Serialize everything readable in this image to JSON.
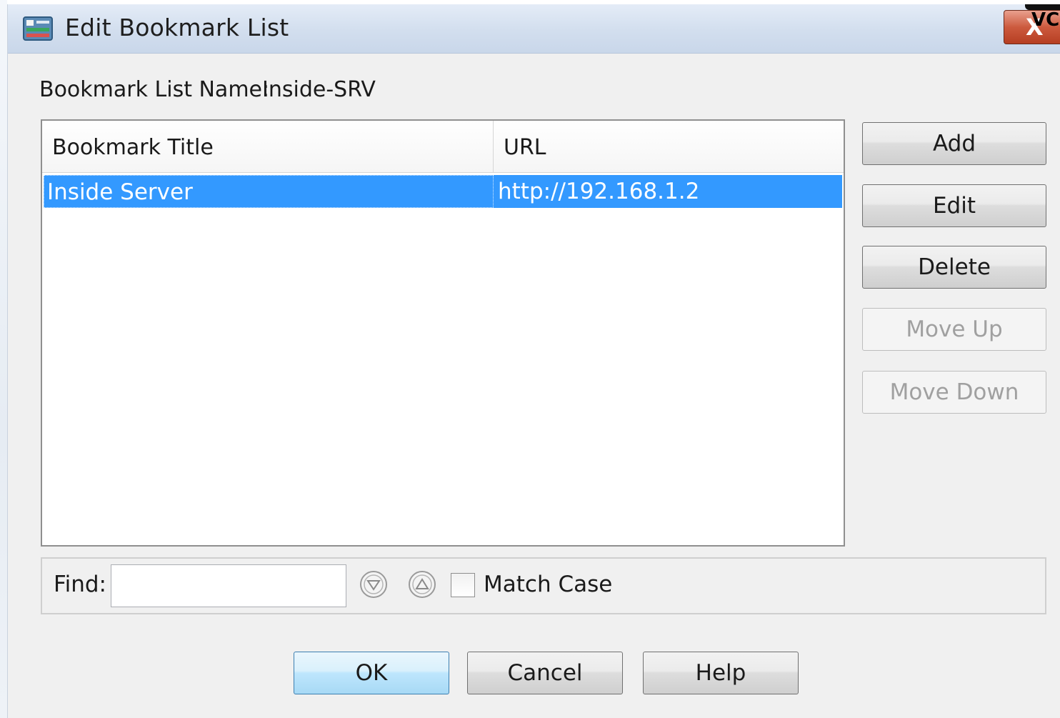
{
  "window": {
    "title": "Edit Bookmark List",
    "close_label": "X",
    "corner_badge": "VCE"
  },
  "form": {
    "list_name_label": "Bookmark List Name:",
    "list_name_value": "Inside-SRV"
  },
  "table": {
    "columns": [
      "Bookmark Title",
      "URL"
    ],
    "rows": [
      {
        "title": "Inside Server",
        "url": "http://192.168.1.2",
        "selected": true
      }
    ]
  },
  "side_buttons": {
    "add": "Add",
    "edit": "Edit",
    "delete": "Delete",
    "move_up": "Move Up",
    "move_down": "Move Down"
  },
  "find": {
    "label": "Find:",
    "value": "",
    "match_case_label": "Match Case",
    "match_case_checked": false
  },
  "bottom_buttons": {
    "ok": "OK",
    "cancel": "Cancel",
    "help": "Help"
  },
  "colors": {
    "selection": "#3399ff",
    "titlebar": "#d2deee",
    "close_button": "#cc5a3e"
  },
  "icons": {
    "app": "bookmark-list-app-icon",
    "find_next": "circle-down-icon",
    "find_prev": "circle-up-icon"
  }
}
